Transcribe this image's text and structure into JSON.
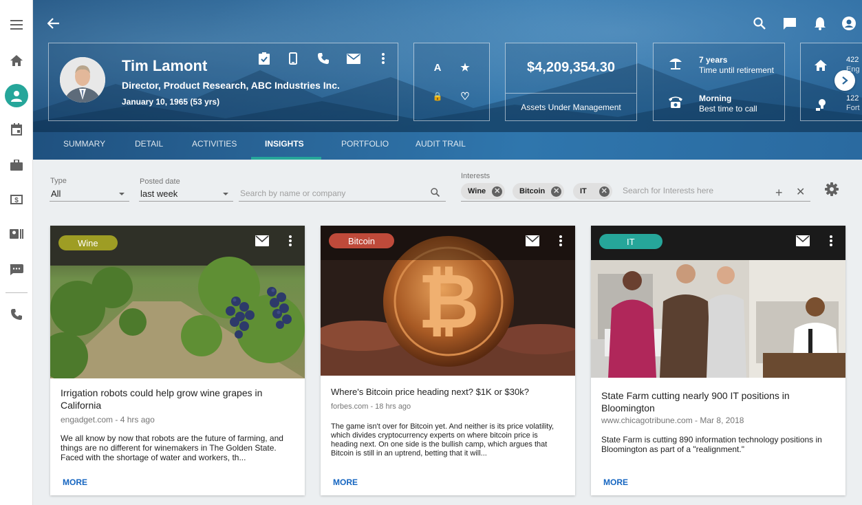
{
  "header": {
    "profile": {
      "name": "Tim Lamont",
      "title": "Director, Product Research, ABC Industries Inc.",
      "dob": "January 10, 1965  (53 yrs)"
    },
    "badges": [
      {
        "label": "A",
        "color": "#f5a623"
      },
      {
        "label": "★",
        "color": "#1e88e5"
      },
      {
        "label": "🔒",
        "color": "#26a69a"
      },
      {
        "label": "♡",
        "color": "#c58ac9"
      }
    ],
    "aum": {
      "value": "$4,209,354.30",
      "label": "Assets Under Management"
    },
    "info": {
      "retirement_value": "7 years",
      "retirement_label": "Time until retirement",
      "call_value": "Morning",
      "call_label": "Best time to call"
    },
    "partial": {
      "line1": "422",
      "line2": "Eng",
      "line3": "122",
      "line4": "Fort"
    },
    "tabs": [
      "SUMMARY",
      "DETAIL",
      "ACTIVITIES",
      "INSIGHTS",
      "PORTFOLIO",
      "AUDIT TRAIL"
    ],
    "active_tab": "INSIGHTS"
  },
  "filters": {
    "type_label": "Type",
    "type_value": "All",
    "posted_label": "Posted date",
    "posted_value": "last week",
    "search_placeholder": "Search by name or company",
    "interests_label": "Interests",
    "chips": [
      "Wine",
      "Bitcoin",
      "IT"
    ],
    "interests_placeholder": "Search for Interests here"
  },
  "cards": [
    {
      "tag": "Wine",
      "tag_color": "#9e9d24",
      "title": "Irrigation robots could help grow wine grapes in California",
      "source": "engadget.com - 4 hrs ago",
      "body": "We all know by now that robots are the future of farming, and things are no different for winemakers in The Golden State. Faced with the shortage of water and workers, th...",
      "more": "MORE"
    },
    {
      "tag": "Bitcoin",
      "tag_color": "#bf4a3a",
      "title": "Where's Bitcoin price heading next? $1K or $30k?",
      "source": "forbes.com - 18 hrs ago",
      "body": "The game isn't over for Bitcoin yet. And neither is its price volatility, which divides cryptocurrency experts on where bitcoin price is heading next. On one side is the bullish camp, which argues that Bitcoin is still in an uptrend, betting that it will...",
      "more": "MORE"
    },
    {
      "tag": "IT",
      "tag_color": "#26a69a",
      "title": "State Farm cutting nearly 900 IT positions in Bloomington",
      "source": "www.chicagotribune.com - Mar 8, 2018",
      "body": "State Farm is cutting 890 information technology positions in Bloomington as part of a \"realignment.\"",
      "more": "MORE"
    }
  ]
}
